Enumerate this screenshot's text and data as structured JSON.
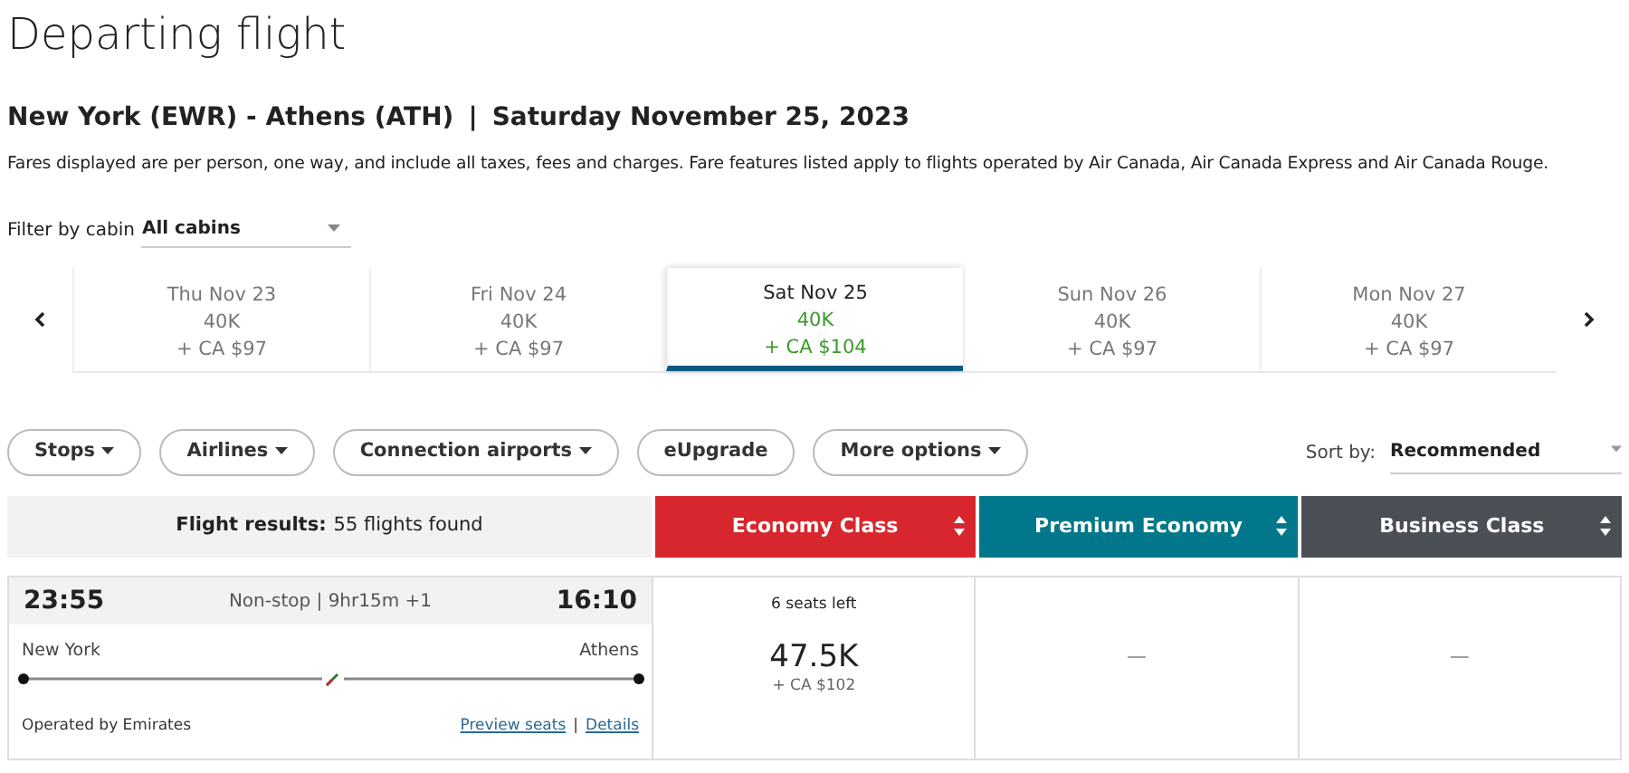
{
  "title": "Departing flight",
  "route": {
    "cities": "New York (EWR) - Athens (ATH)",
    "separator": "|",
    "date": "Saturday November 25, 2023"
  },
  "notice": "Fares displayed are per person, one way, and include all taxes, fees and charges. Fare features listed apply to flights operated by Air Canada, Air Canada Express and Air Canada Rouge.",
  "cabin_filter": {
    "label": "Filter by cabin",
    "value": "All cabins"
  },
  "dates": [
    {
      "day": "Thu Nov 23",
      "points": "40K",
      "cash": "+ CA $97",
      "selected": false
    },
    {
      "day": "Fri Nov 24",
      "points": "40K",
      "cash": "+ CA $97",
      "selected": false
    },
    {
      "day": "Sat Nov 25",
      "points": "40K",
      "cash": "+ CA $104",
      "selected": true
    },
    {
      "day": "Sun Nov 26",
      "points": "40K",
      "cash": "+ CA $97",
      "selected": false
    },
    {
      "day": "Mon Nov 27",
      "points": "40K",
      "cash": "+ CA $97",
      "selected": false
    }
  ],
  "filters": [
    {
      "label": "Stops",
      "dropdown": true
    },
    {
      "label": "Airlines",
      "dropdown": true
    },
    {
      "label": "Connection airports",
      "dropdown": true
    },
    {
      "label": "eUpgrade",
      "dropdown": false
    },
    {
      "label": "More options",
      "dropdown": true
    }
  ],
  "sort": {
    "label": "Sort by:",
    "value": "Recommended"
  },
  "results": {
    "label": "Flight results:",
    "count": "55 flights found"
  },
  "cabins": [
    {
      "name": "Economy Class",
      "color": "#d8262e"
    },
    {
      "name": "Premium Economy",
      "color": "#00778a"
    },
    {
      "name": "Business Class",
      "color": "#4a4f55"
    }
  ],
  "flights": [
    {
      "depart": "23:55",
      "stops": "Non-stop | 9hr15m +1",
      "arrive": "16:10",
      "origin": "New York",
      "destination": "Athens",
      "operator": "Operated by Emirates",
      "links": [
        "Preview seats",
        "Details"
      ],
      "link_separator": "|",
      "fares": [
        {
          "kind": "fare",
          "seats": "6 seats left",
          "points": "47.5K",
          "cash": "+ CA $102"
        },
        {
          "kind": "none",
          "text": "—"
        },
        {
          "kind": "none",
          "text": "—"
        }
      ]
    }
  ]
}
